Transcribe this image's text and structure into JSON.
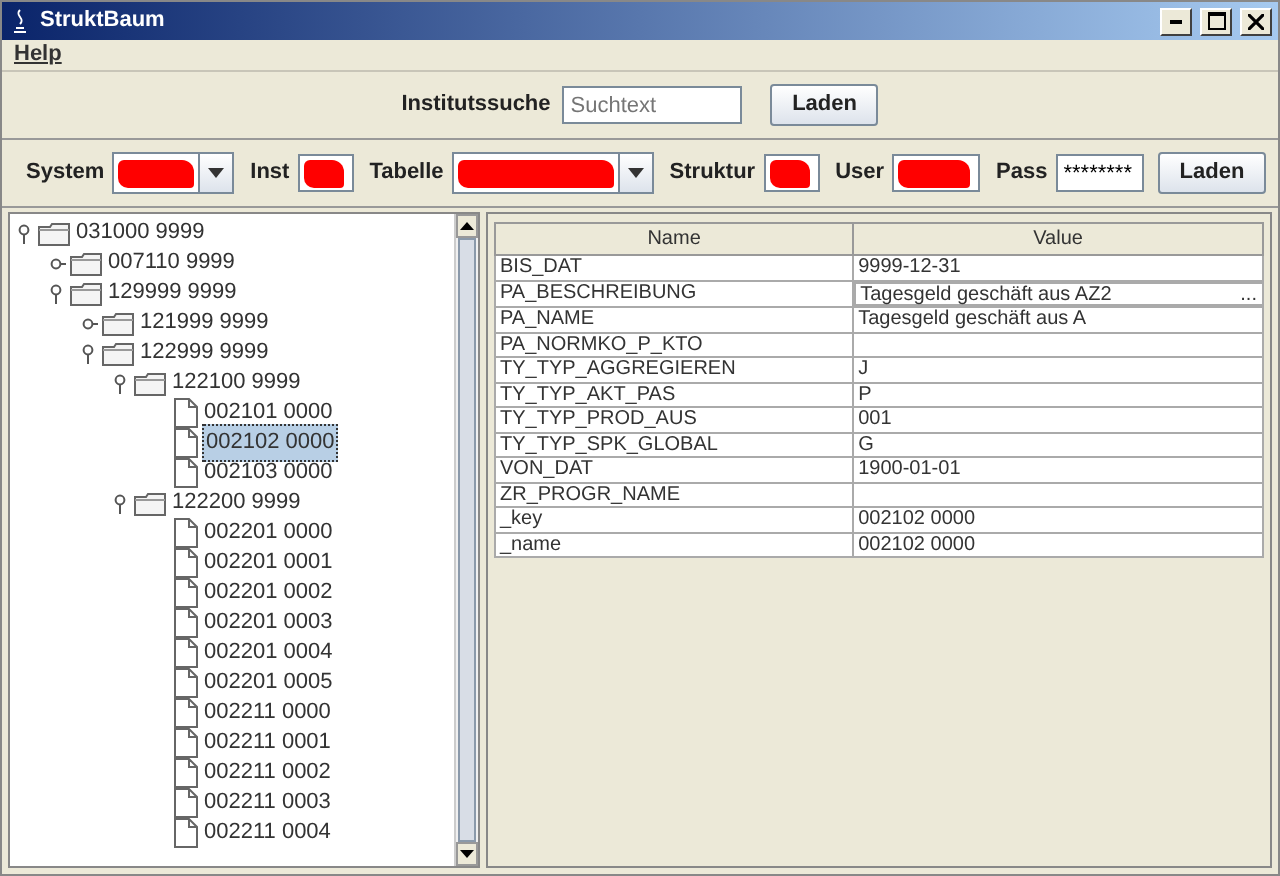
{
  "window": {
    "title": "StruktBaum"
  },
  "menu": [
    {
      "label": "Help"
    }
  ],
  "search": {
    "label": "Institutssuche",
    "placeholder": "Suchtext",
    "button": "Laden"
  },
  "connection": {
    "fields": [
      {
        "label": "System",
        "kind": "combo",
        "redacted": true
      },
      {
        "label": "Inst",
        "kind": "text",
        "redacted": true
      },
      {
        "label": "Tabelle",
        "kind": "combo",
        "redacted": true
      },
      {
        "label": "Struktur",
        "kind": "text",
        "redacted": true
      },
      {
        "label": "User",
        "kind": "text",
        "redacted": true
      },
      {
        "label": "Pass",
        "kind": "password",
        "value": "********"
      }
    ],
    "button": "Laden"
  },
  "tree": [
    {
      "label": "031000 9999",
      "kind": "folder",
      "expanded": true,
      "selected": false,
      "children": [
        {
          "label": "007110 9999",
          "kind": "folder",
          "expanded": false,
          "selected": false
        },
        {
          "label": "129999 9999",
          "kind": "folder",
          "expanded": true,
          "selected": false,
          "children": [
            {
              "label": "121999 9999",
              "kind": "folder",
              "expanded": false,
              "selected": false
            },
            {
              "label": "122999 9999",
              "kind": "folder",
              "expanded": true,
              "selected": false,
              "children": [
                {
                  "label": "122100 9999",
                  "kind": "folder",
                  "expanded": true,
                  "selected": false,
                  "children": [
                    {
                      "label": "002101 0000",
                      "kind": "file",
                      "selected": false
                    },
                    {
                      "label": "002102 0000",
                      "kind": "file",
                      "selected": true
                    },
                    {
                      "label": "002103 0000",
                      "kind": "file",
                      "selected": false
                    }
                  ]
                },
                {
                  "label": "122200 9999",
                  "kind": "folder",
                  "expanded": true,
                  "selected": false,
                  "children": [
                    {
                      "label": "002201 0000",
                      "kind": "file",
                      "selected": false
                    },
                    {
                      "label": "002201 0001",
                      "kind": "file",
                      "selected": false
                    },
                    {
                      "label": "002201 0002",
                      "kind": "file",
                      "selected": false
                    },
                    {
                      "label": "002201 0003",
                      "kind": "file",
                      "selected": false
                    },
                    {
                      "label": "002201 0004",
                      "kind": "file",
                      "selected": false
                    },
                    {
                      "label": "002201 0005",
                      "kind": "file",
                      "selected": false
                    },
                    {
                      "label": "002211 0000",
                      "kind": "file",
                      "selected": false
                    },
                    {
                      "label": "002211 0001",
                      "kind": "file",
                      "selected": false
                    },
                    {
                      "label": "002211 0002",
                      "kind": "file",
                      "selected": false
                    },
                    {
                      "label": "002211 0003",
                      "kind": "file",
                      "selected": false
                    },
                    {
                      "label": "002211 0004",
                      "kind": "file",
                      "selected": false
                    }
                  ]
                }
              ]
            }
          ]
        }
      ]
    }
  ],
  "table": {
    "columns": [
      "Name",
      "Value"
    ],
    "rows": [
      {
        "name": "BIS_DAT",
        "value": "9999-12-31"
      },
      {
        "name": "PA_BESCHREIBUNG",
        "value": "Tagesgeld geschäft aus AZ2",
        "more": "..."
      },
      {
        "name": "PA_NAME",
        "value": "Tagesgeld geschäft aus A"
      },
      {
        "name": "PA_NORMKO_P_KTO",
        "value": ""
      },
      {
        "name": "TY_TYP_AGGREGIEREN",
        "value": "J"
      },
      {
        "name": "TY_TYP_AKT_PAS",
        "value": "P"
      },
      {
        "name": "TY_TYP_PROD_AUS",
        "value": "001"
      },
      {
        "name": "TY_TYP_SPK_GLOBAL",
        "value": "G"
      },
      {
        "name": "VON_DAT",
        "value": "1900-01-01"
      },
      {
        "name": "ZR_PROGR_NAME",
        "value": ""
      },
      {
        "name": "_key",
        "value": "002102 0000"
      },
      {
        "name": "_name",
        "value": "002102 0000"
      }
    ]
  }
}
